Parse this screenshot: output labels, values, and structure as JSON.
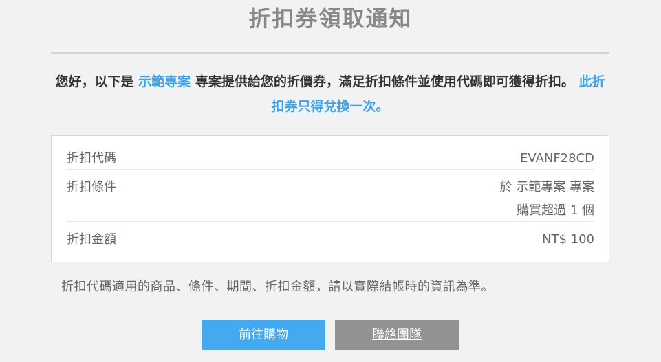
{
  "page": {
    "title": "折扣券領取通知"
  },
  "intro": {
    "prefix": "您好，以下是",
    "store_name": "示範專案",
    "middle": "專案提供給您的折價券，滿足折扣條件並使用代碼即可獲得折扣。",
    "notice": "此折扣券只得兌換一次。"
  },
  "coupon": {
    "code_label": "折扣代碼",
    "code_value": "EVANF28CD",
    "condition_label": "折扣條件",
    "condition_line1": "於 示範專案 專案",
    "condition_line2": "購買超過 1 個",
    "amount_label": "折扣金額",
    "amount_value": "NT$ 100"
  },
  "note": "折扣代碼適用的商品、條件、期間、折扣金額，請以實際結帳時的資訊為準。",
  "buttons": {
    "shop_label": "前往購物",
    "contact_label": "聯絡團隊"
  },
  "colors": {
    "background": "#f2f2f2",
    "accent": "#3ea2ea",
    "primary_button": "#43a9f0",
    "secondary_button": "#929292",
    "title": "#888888"
  }
}
